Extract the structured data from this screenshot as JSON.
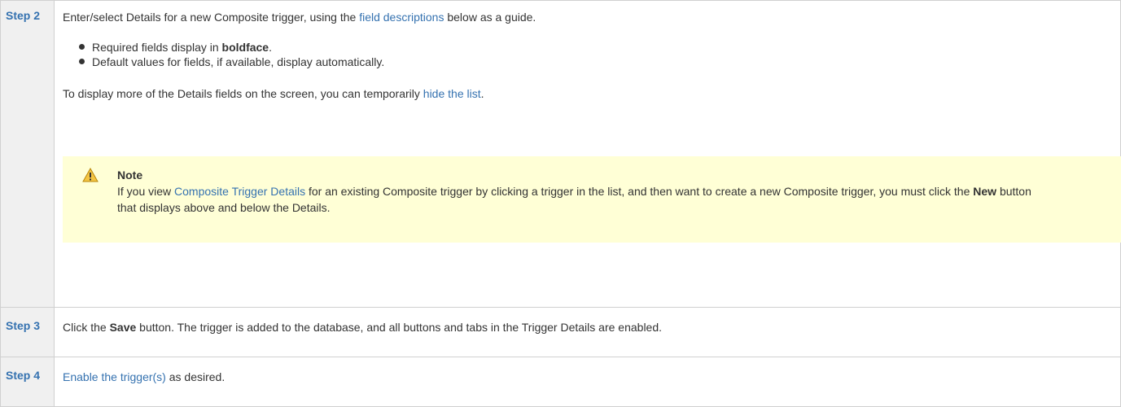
{
  "steps": [
    {
      "label": "Step 2",
      "intro_before": "Enter/select Details for a new Composite trigger, using the ",
      "intro_link": "field descriptions",
      "intro_after": " below as a guide.",
      "bullets": [
        {
          "before": "Required fields display in ",
          "bold": "boldface",
          "after": "."
        },
        {
          "before": "Default values for fields, if available, display automatically.",
          "bold": "",
          "after": ""
        }
      ],
      "para_before": "To display more of the Details fields on the screen, you can temporarily ",
      "para_link": "hide the list",
      "para_after": ".",
      "note": {
        "icon": "warning-icon",
        "title": "Note",
        "text_before": "If you view ",
        "text_link": "Composite Trigger Details",
        "text_middle": " for an existing Composite trigger by clicking a trigger in the list, and then want to create a new Composite trigger, you must click the ",
        "text_bold": "New",
        "text_after": " button that displays above and below the Details."
      }
    },
    {
      "label": "Step 3",
      "text_before": "Click the ",
      "text_bold": "Save",
      "text_after": " button. The trigger is added to the database, and all buttons and tabs in the Trigger Details are enabled."
    },
    {
      "label": "Step 4",
      "link": "Enable the trigger(s)",
      "text_after": " as desired."
    }
  ],
  "colors": {
    "link": "#3572b0",
    "label_bg": "#f0f0f0",
    "note_bg": "#ffffd6",
    "warning_icon": "#f4c542"
  }
}
